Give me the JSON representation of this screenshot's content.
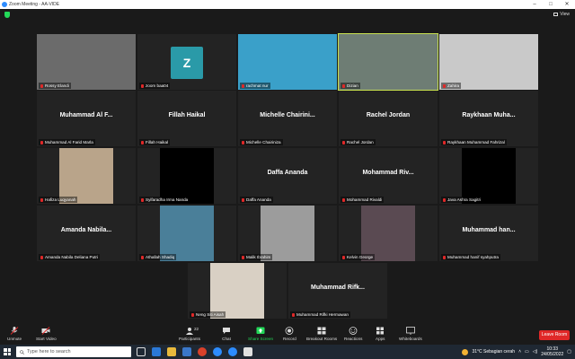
{
  "window": {
    "title": "Zoom Meeting - AA-VIDE"
  },
  "top": {
    "view_label": "View"
  },
  "participants": [
    {
      "label": "Rossy Elandi",
      "display_name": "",
      "type": "video",
      "bg": "#6b6b6b"
    },
    {
      "label": "zoom baa04",
      "display_name": "",
      "type": "avatar",
      "avatar_letter": "Z"
    },
    {
      "label": "rachmat nur",
      "display_name": "",
      "type": "video",
      "bg": "#3aa0c9"
    },
    {
      "label": "Dizian",
      "display_name": "",
      "type": "video",
      "bg": "#6e7d74",
      "active": true
    },
    {
      "label": "Zahira",
      "display_name": "",
      "type": "video",
      "bg": "#c9c9c9"
    },
    {
      "label": "Muhammad Al Farid Marla",
      "display_name": "Muhammad  Al  F...",
      "type": "name"
    },
    {
      "label": "Fillah Haikal",
      "display_name": "Fillah Haikal",
      "type": "name"
    },
    {
      "label": "Michelle Chairiniza",
      "display_name": "Michelle  Chairini...",
      "type": "name"
    },
    {
      "label": "Rachel Jordan",
      "display_name": "Rachel Jordan",
      "type": "name"
    },
    {
      "label": "Raykhaan Muhammad Fahrizal",
      "display_name": "Raykhaan  Muha...",
      "type": "name"
    },
    {
      "label": "Hafiza Luqyanah",
      "display_name": "",
      "type": "photo",
      "bg": "#b9a48a"
    },
    {
      "label": "Syifaradha Irma Nanda",
      "display_name": "",
      "type": "black"
    },
    {
      "label": "Daffa Ananda",
      "display_name": "Daffa Ananda",
      "type": "name"
    },
    {
      "label": "Mohammad Rivaldi",
      "display_name": "Mohammad  Riv...",
      "type": "name"
    },
    {
      "label": "Java Ashra Sagitri",
      "display_name": "",
      "type": "black"
    },
    {
      "label": "Amanda Nabila Deliana Putri",
      "display_name": "Amanda  Nabila...",
      "type": "name"
    },
    {
      "label": "Athallah Shadiq",
      "display_name": "",
      "type": "photo",
      "bg": "#4a7f99"
    },
    {
      "label": "Malik Ibrahim",
      "display_name": "",
      "type": "photo",
      "bg": "#9c9c9c"
    },
    {
      "label": "Kelvin George",
      "display_name": "",
      "type": "photo",
      "bg": "#5a4a52"
    },
    {
      "label": "Muhammad hanif syahputra",
      "display_name": "Muhammad  han...",
      "type": "name"
    },
    {
      "label": "Neng Siti Aisah",
      "display_name": "",
      "type": "photo",
      "bg": "#d9d0c4"
    },
    {
      "label": "Muhammad Rifki Hermawan",
      "display_name": "Muhammad  Rifk...",
      "type": "name"
    }
  ],
  "toolbar": {
    "unmute": "Unmute",
    "start_video": "Start Video",
    "participants": "Participants",
    "participants_count": "22",
    "chat": "Chat",
    "share_screen": "Share Screen",
    "record": "Record",
    "breakout": "Breakout Rooms",
    "reactions": "Reactions",
    "apps": "Apps",
    "whiteboards": "Whiteboards",
    "leave": "Leave Room"
  },
  "taskbar": {
    "search_placeholder": "Type here to search",
    "weather": "31°C  Sebagian cerah",
    "time": "10:33",
    "date": "24/05/2022"
  },
  "colors": {
    "accent_green": "#23d959",
    "leave_red": "#e02828",
    "active_border": "#c9e24f"
  }
}
